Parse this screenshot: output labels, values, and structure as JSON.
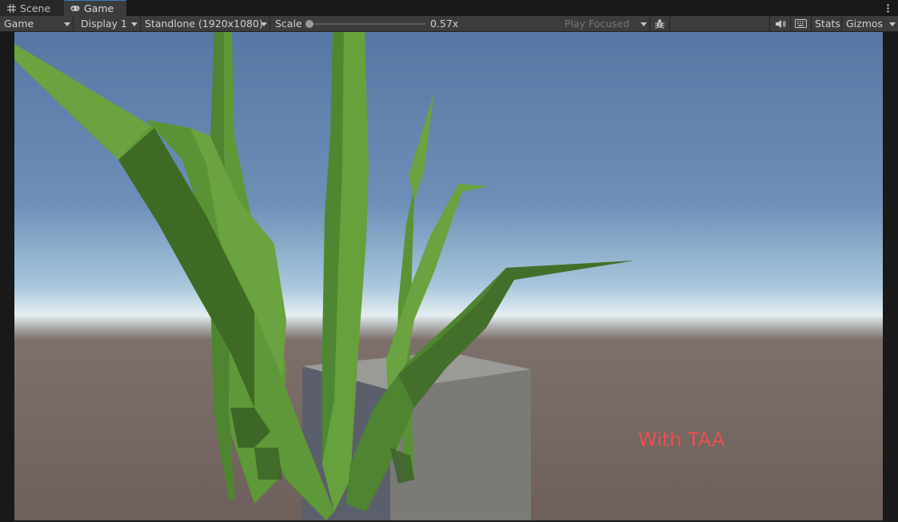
{
  "tabs": [
    {
      "label": "Scene",
      "icon": "grid-icon"
    },
    {
      "label": "Game",
      "icon": "gamepad-icon"
    }
  ],
  "toolbar": {
    "view_mode": "Game",
    "display": "Display 1",
    "resolution": "Standlone (1920x1080)",
    "scale_label": "Scale",
    "scale_value": "0.57x",
    "play_mode": "Play Focused",
    "stats_label": "Stats",
    "gizmos_label": "Gizmos"
  },
  "viewport": {
    "overlay_text": "With TAA",
    "overlay_color": "#e85151",
    "sky_top": "#5677a3",
    "horizon": "#e4eef2",
    "ground": "#6e5f5a",
    "grass_light": "#6aa33f",
    "grass_dark": "#3f6a26",
    "cube": "#7a7a76"
  }
}
